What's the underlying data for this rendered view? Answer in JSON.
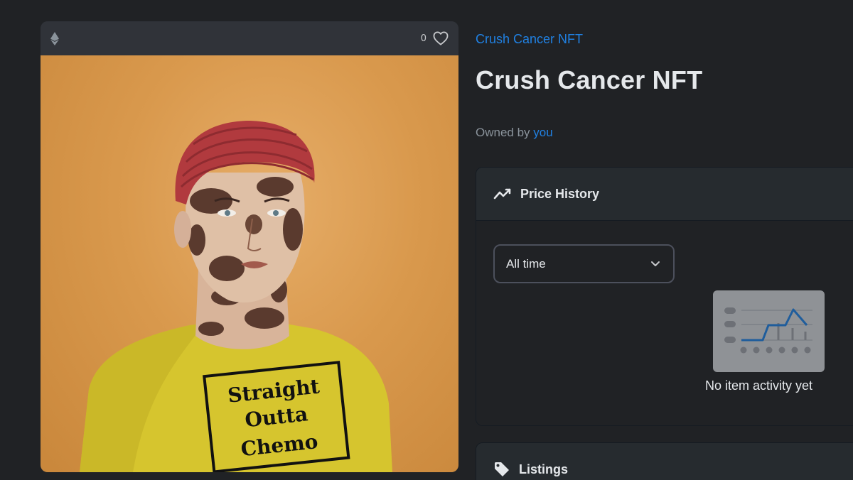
{
  "asset": {
    "favorites_count": "0",
    "chain_icon": "ethereum-icon",
    "artwork_shirt_text": [
      "Straight",
      "Outta",
      "Chemo"
    ]
  },
  "collection": {
    "name": "Crush Cancer NFT"
  },
  "item": {
    "title": "Crush Cancer NFT"
  },
  "ownership": {
    "prefix": "Owned by",
    "owner": "you"
  },
  "price_history": {
    "title": "Price History",
    "icon": "trend-line-icon",
    "range_select": {
      "value": "All time",
      "icon": "chevron-down-icon"
    },
    "empty_message": "No item activity yet"
  },
  "listings": {
    "title": "Listings",
    "icon": "tag-icon"
  },
  "colors": {
    "page_background": "#202225",
    "accent_link": "#2081e2",
    "panel_background": "#262b2f",
    "text_primary": "#e5e8eb",
    "text_secondary": "#8a939b"
  }
}
